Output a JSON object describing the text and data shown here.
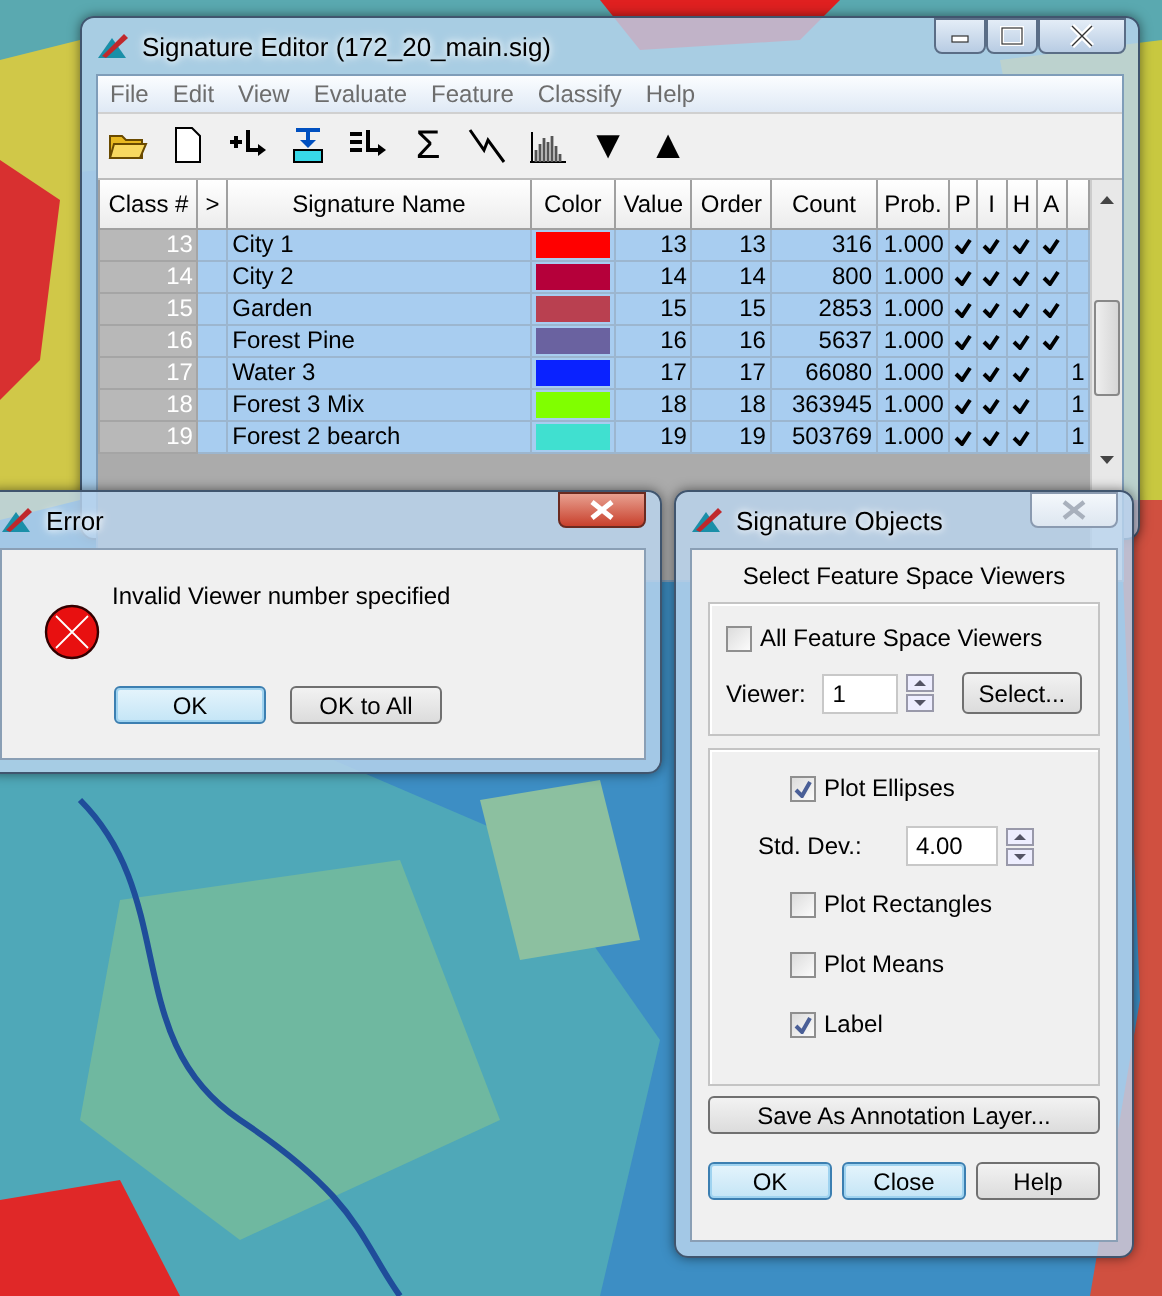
{
  "signature_editor": {
    "title": "Signature Editor (172_20_main.sig)",
    "menu": [
      "File",
      "Edit",
      "View",
      "Evaluate",
      "Feature",
      "Classify",
      "Help"
    ],
    "toolbar": [
      {
        "kind": "open-folder"
      },
      {
        "kind": "new-file"
      },
      {
        "kind": "add-row"
      },
      {
        "kind": "replace"
      },
      {
        "kind": "merge"
      },
      {
        "kind": "glyph",
        "text": "Σ"
      },
      {
        "kind": "line-graph"
      },
      {
        "kind": "histogram"
      },
      {
        "kind": "glyph",
        "text": "▼"
      },
      {
        "kind": "glyph",
        "text": "▲"
      }
    ],
    "table": {
      "columns": [
        "Class #",
        ">",
        "Signature Name",
        "Color",
        "Value",
        "Order",
        "Count",
        "Prob.",
        "P",
        "I",
        "H",
        "A"
      ],
      "rows": [
        {
          "class": "13",
          "name": "City 1",
          "color": "#ff0000",
          "value": "13",
          "order": "13",
          "count": "316",
          "prob": "1.000",
          "p": true,
          "i": true,
          "h": true,
          "a": true,
          "selected": true
        },
        {
          "class": "14",
          "name": "City 2",
          "color": "#b5003a",
          "value": "14",
          "order": "14",
          "count": "800",
          "prob": "1.000",
          "p": true,
          "i": true,
          "h": true,
          "a": true,
          "selected": true
        },
        {
          "class": "15",
          "name": "Garden",
          "color": "#b94050",
          "value": "15",
          "order": "15",
          "count": "2853",
          "prob": "1.000",
          "p": true,
          "i": true,
          "h": true,
          "a": true,
          "selected": true
        },
        {
          "class": "16",
          "name": "Forest Pine",
          "color": "#6a62a0",
          "value": "16",
          "order": "16",
          "count": "5637",
          "prob": "1.000",
          "p": true,
          "i": true,
          "h": true,
          "a": true,
          "selected": true
        },
        {
          "class": "17",
          "name": "Water 3",
          "color": "#0a22ff",
          "value": "17",
          "order": "17",
          "count": "66080",
          "prob": "1.000",
          "p": true,
          "i": true,
          "h": true,
          "a": false,
          "column_13": "1",
          "selected": true
        },
        {
          "class": "18",
          "name": "Forest 3 Mix",
          "color": "#80ff00",
          "value": "18",
          "order": "18",
          "count": "363945",
          "prob": "1.000",
          "p": true,
          "i": true,
          "h": true,
          "a": false,
          "column_13": "1",
          "selected": true
        },
        {
          "class": "19",
          "name": "Forest 2 bearch",
          "color": "#40e0d0",
          "value": "19",
          "order": "19",
          "count": "503769",
          "prob": "1.000",
          "p": true,
          "i": true,
          "h": true,
          "a": false,
          "column_13": "1",
          "selected": true
        }
      ]
    }
  },
  "error_dialog": {
    "title": "Error",
    "message": "Invalid Viewer number specified",
    "buttons": [
      {
        "label": "OK",
        "default": true
      },
      {
        "label": "OK to All",
        "default": false
      }
    ]
  },
  "signature_objects": {
    "title": "Signature Objects",
    "heading": "Select Feature Space Viewers",
    "all_viewers": {
      "label": "All Feature Space Viewers",
      "checked": false
    },
    "viewer": {
      "label": "Viewer:",
      "value": "1"
    },
    "select_button": "Select...",
    "options": [
      {
        "kind": "checkbox",
        "label": "Plot Ellipses",
        "checked": true
      },
      {
        "kind": "spinner",
        "label": "Std. Dev.:",
        "value": "4.00"
      },
      {
        "kind": "checkbox",
        "label": "Plot Rectangles",
        "checked": false
      },
      {
        "kind": "checkbox",
        "label": "Plot Means",
        "checked": false
      },
      {
        "kind": "checkbox",
        "label": "Label",
        "checked": true
      }
    ],
    "save_button": "Save As Annotation Layer...",
    "buttons": [
      {
        "label": "OK",
        "default": true
      },
      {
        "label": "Close",
        "default": true
      },
      {
        "label": "Help",
        "default": false
      }
    ]
  }
}
